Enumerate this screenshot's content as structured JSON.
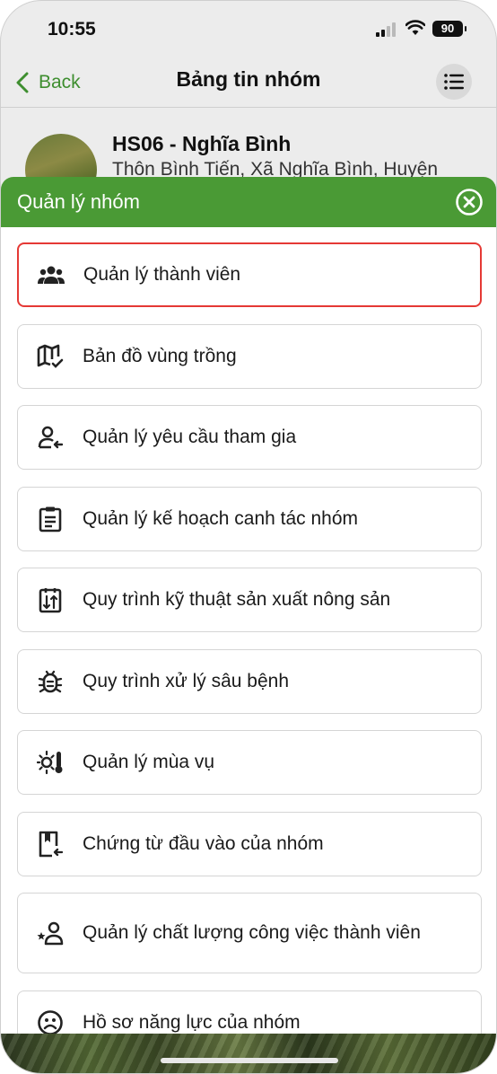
{
  "status_bar": {
    "time": "10:55",
    "battery": "90"
  },
  "nav": {
    "back_label": "Back",
    "title": "Bảng tin nhóm"
  },
  "group": {
    "name": "HS06 - Nghĩa Bình",
    "address": "Thôn Bình Tiến, Xã Nghĩa Bình, Huyện"
  },
  "sheet": {
    "title": "Quản lý nhóm",
    "items": [
      {
        "label": "Quản lý thành viên",
        "icon": "members-icon",
        "selected": true
      },
      {
        "label": "Bản đồ vùng trồng",
        "icon": "map-icon"
      },
      {
        "label": "Quản lý yêu cầu tham gia",
        "icon": "join-request-icon"
      },
      {
        "label": "Quản lý kế hoạch canh tác nhóm",
        "icon": "clipboard-icon"
      },
      {
        "label": "Quy trình kỹ thuật sản xuất nông sản",
        "icon": "process-icon"
      },
      {
        "label": "Quy trình xử lý sâu bệnh",
        "icon": "bug-icon"
      },
      {
        "label": "Quản lý mùa vụ",
        "icon": "season-icon"
      },
      {
        "label": "Chứng từ đầu vào của nhóm",
        "icon": "document-icon"
      },
      {
        "label": "Quản lý chất lượng công việc thành viên",
        "icon": "quality-icon"
      },
      {
        "label": "Hồ sơ năng lực của nhóm",
        "icon": "profile-icon"
      }
    ]
  },
  "colors": {
    "accent": "#4a9a35",
    "back_link": "#3e8e2f",
    "selected_border": "#e53935"
  }
}
